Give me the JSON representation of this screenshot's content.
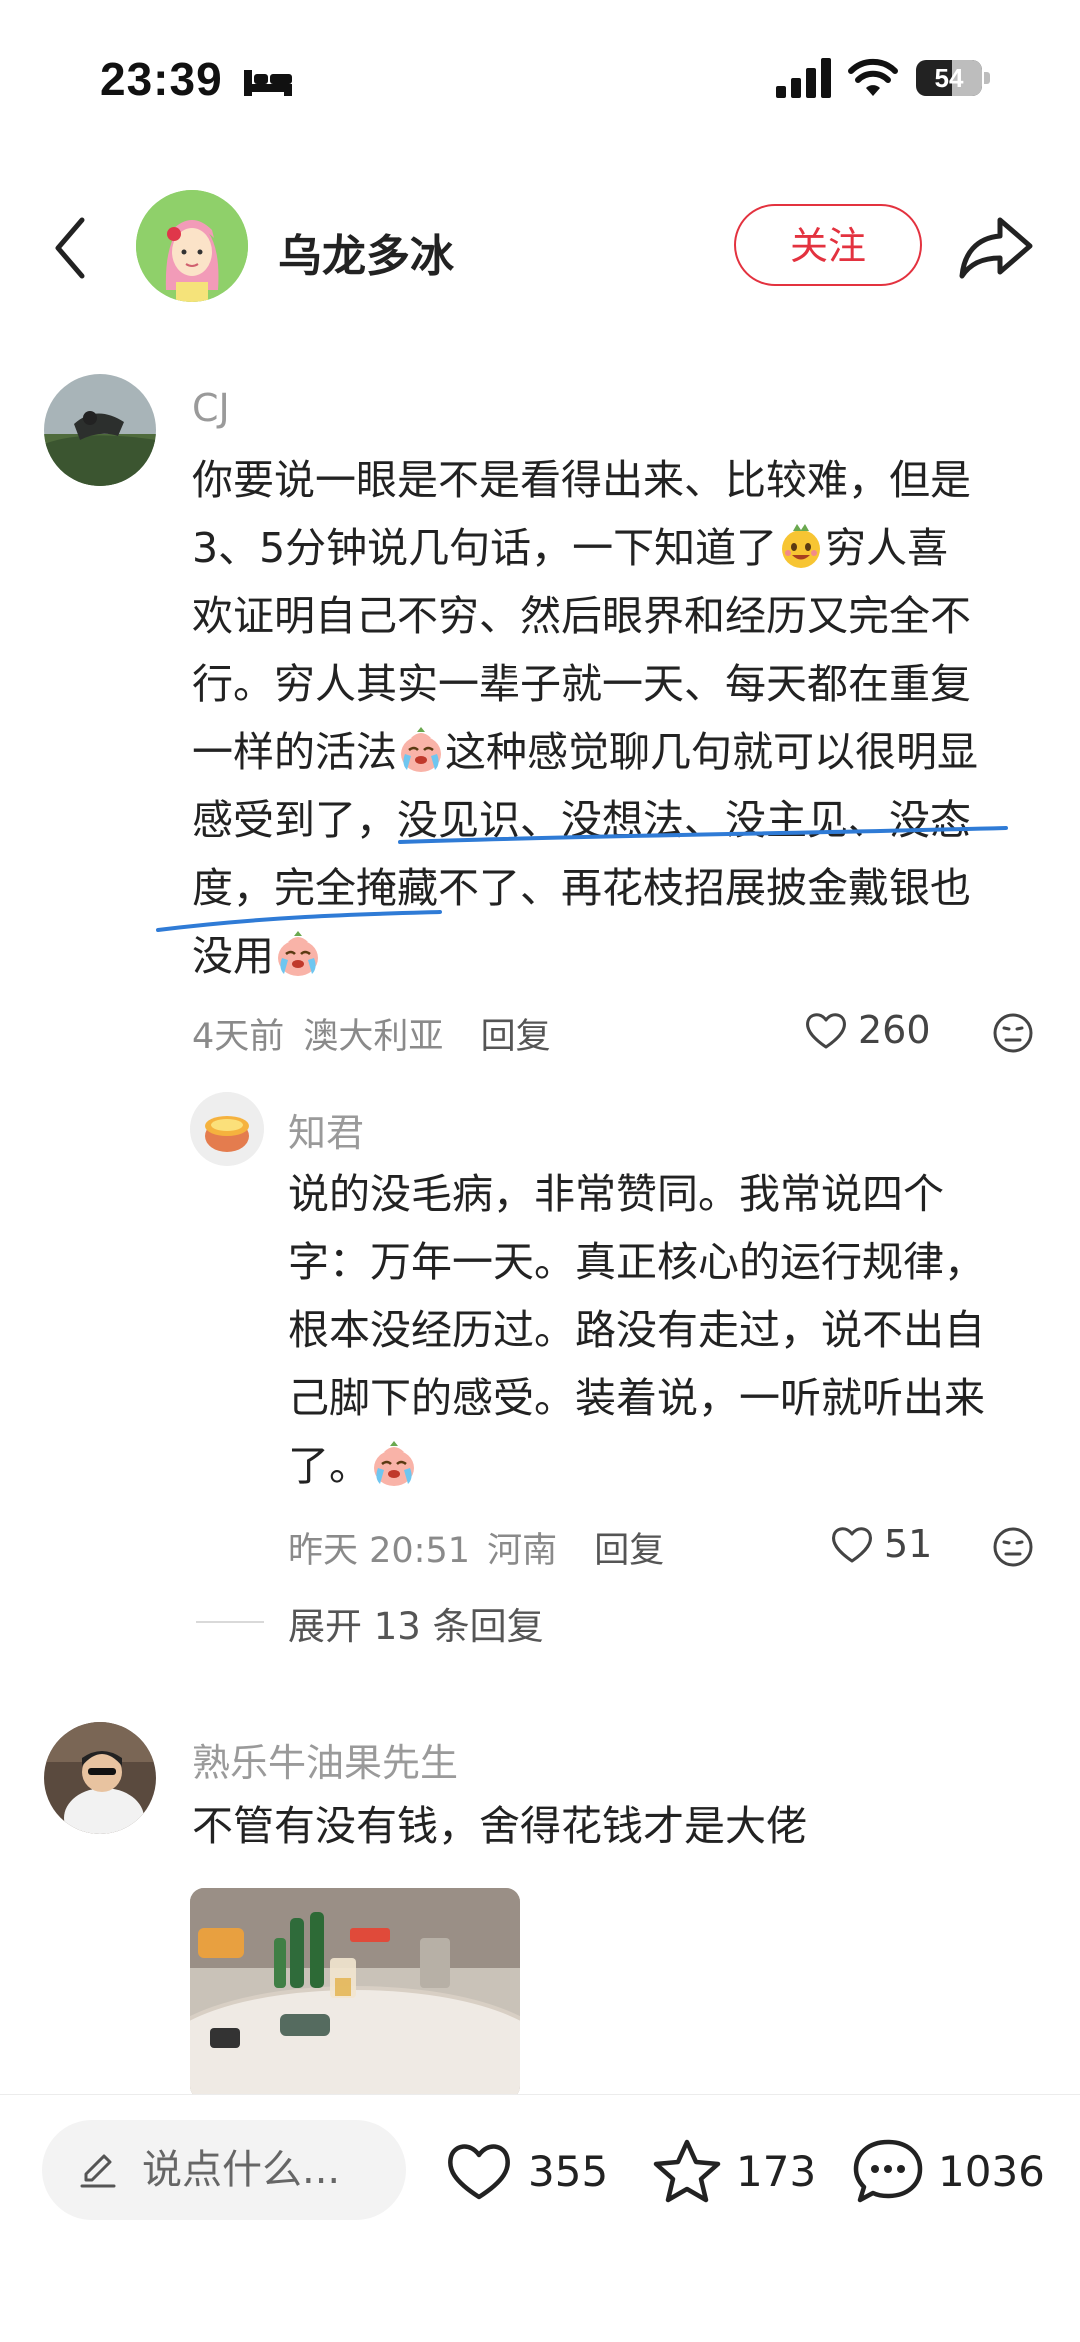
{
  "status_bar": {
    "time": "23:39",
    "battery": "54"
  },
  "header": {
    "author_name": "乌龙多冰",
    "follow_label": "关注"
  },
  "comments": [
    {
      "username": "CJ",
      "lines": [
        "你要说一眼是不是看得出来、比较难，但是",
        "3、5分钟说几句话，一下知道了",
        "穷人喜",
        "欢证明自己不穷、然后眼界和经历又完全不",
        "行。穷人其实一辈子就一天、每天都在重复",
        "一样的活法",
        "这种感觉聊几句就可以很明显",
        "感受到了，没见识、没想法、没主见、没态",
        "度，完全掩藏不了、再花枝招展披金戴银也",
        "没用"
      ],
      "time_ago": "4天前",
      "location": "澳大利亚",
      "reply_label": "回复",
      "likes": "260",
      "reply": {
        "username": "知君",
        "lines": [
          "说的没毛病，非常赞同。我常说四个",
          "字：万年一天。真正核心的运行规律，",
          "根本没经历过。路没有走过，说不出自",
          "己脚下的感受。装着说，一听就听出来",
          "了。"
        ],
        "time_ago": "昨天 20:51",
        "location": "河南",
        "reply_label": "回复",
        "likes": "51"
      },
      "expand_label": "展开 13 条回复"
    },
    {
      "username": "熟乐牛油果先生",
      "text": "不管有没有钱，舍得花钱才是大佬"
    }
  ],
  "bottom_bar": {
    "input_placeholder": "说点什么...",
    "likes": "355",
    "favorites": "173",
    "comments": "1036"
  },
  "colors": {
    "accent": "#e3323f",
    "underline": "#2f7bd6"
  },
  "icons": [
    "back-icon",
    "share-icon",
    "heart-icon",
    "star-icon",
    "chat-bubble-icon",
    "pencil-icon",
    "emoji-face-icon"
  ]
}
